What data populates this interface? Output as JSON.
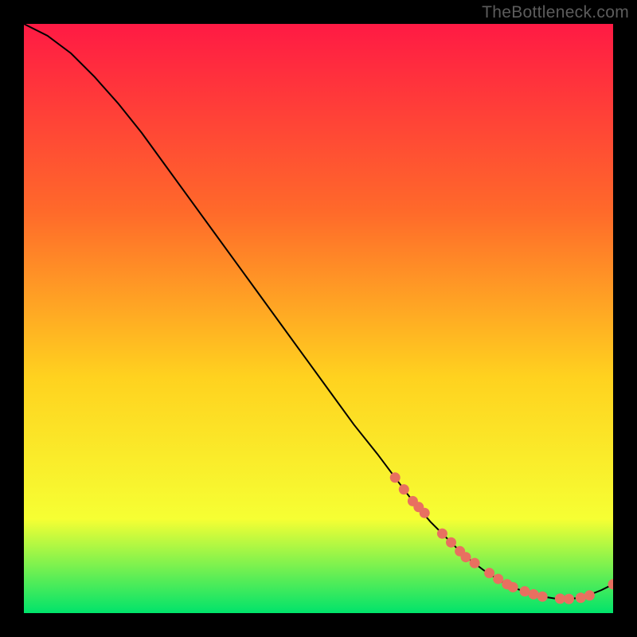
{
  "watermark": "TheBottleneck.com",
  "colors": {
    "background": "#000000",
    "gradient_top": "#ff1a44",
    "gradient_mid1": "#ff6a2a",
    "gradient_mid2": "#ffd21f",
    "gradient_mid3": "#f6ff33",
    "gradient_bottom": "#00e36b",
    "curve": "#000000",
    "marker": "#e87060"
  },
  "chart_data": {
    "type": "line",
    "title": "",
    "xlabel": "",
    "ylabel": "",
    "xlim": [
      0,
      100
    ],
    "ylim": [
      0,
      100
    ],
    "series": [
      {
        "name": "bottleneck-curve",
        "x": [
          0,
          4,
          8,
          12,
          16,
          20,
          24,
          28,
          32,
          36,
          40,
          44,
          48,
          52,
          56,
          60,
          63,
          66,
          69,
          72,
          74,
          76,
          78,
          80,
          82,
          84,
          86,
          88,
          90,
          92,
          94,
          96,
          98,
          100
        ],
        "y": [
          100,
          98,
          95,
          91,
          86.5,
          81.5,
          76,
          70.5,
          65,
          59.5,
          54,
          48.5,
          43,
          37.5,
          32,
          27,
          23,
          19,
          15.5,
          12.5,
          10.5,
          8.8,
          7.3,
          6.0,
          4.9,
          4.0,
          3.3,
          2.8,
          2.5,
          2.4,
          2.55,
          3.1,
          3.9,
          4.9
        ]
      }
    ],
    "markers": {
      "name": "highlighted-points",
      "x": [
        63,
        64.5,
        66,
        67,
        68,
        71,
        72.5,
        74,
        75,
        76.5,
        79,
        80.5,
        82,
        83,
        85,
        86.5,
        88,
        91,
        92.5,
        94.5,
        96,
        100
      ],
      "y": [
        23,
        21,
        19,
        18,
        17,
        13.5,
        12,
        10.5,
        9.5,
        8.5,
        6.8,
        5.8,
        4.9,
        4.4,
        3.7,
        3.2,
        2.8,
        2.45,
        2.4,
        2.6,
        3.0,
        4.9
      ]
    }
  }
}
